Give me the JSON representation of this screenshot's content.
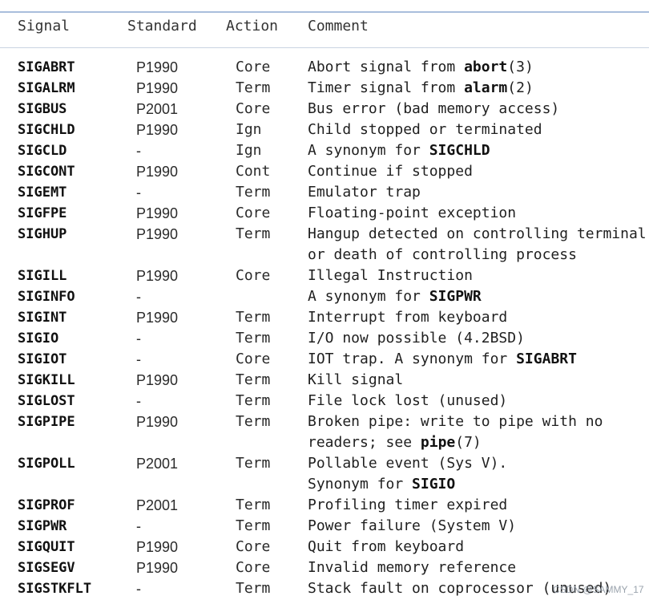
{
  "table": {
    "headers": {
      "signal": "Signal",
      "standard": "Standard",
      "action": "Action",
      "comment": "Comment"
    },
    "rows": [
      {
        "signal": "SIGABRT",
        "standard": "P1990",
        "action": "Core",
        "comment": [
          [
            {
              "t": "Abort signal from "
            },
            {
              "t": "abort",
              "b": true
            },
            {
              "t": "(3)"
            }
          ]
        ]
      },
      {
        "signal": "SIGALRM",
        "standard": "P1990",
        "action": "Term",
        "comment": [
          [
            {
              "t": "Timer signal from "
            },
            {
              "t": "alarm",
              "b": true
            },
            {
              "t": "(2)"
            }
          ]
        ]
      },
      {
        "signal": "SIGBUS",
        "standard": "P2001",
        "action": "Core",
        "comment": [
          [
            {
              "t": "Bus error (bad memory access)"
            }
          ]
        ]
      },
      {
        "signal": "SIGCHLD",
        "standard": "P1990",
        "action": "Ign",
        "comment": [
          [
            {
              "t": "Child stopped or terminated"
            }
          ]
        ]
      },
      {
        "signal": "SIGCLD",
        "standard": "-",
        "action": "Ign",
        "comment": [
          [
            {
              "t": "A synonym for "
            },
            {
              "t": "SIGCHLD",
              "b": true
            }
          ]
        ]
      },
      {
        "signal": "SIGCONT",
        "standard": "P1990",
        "action": "Cont",
        "comment": [
          [
            {
              "t": "Continue if stopped"
            }
          ]
        ]
      },
      {
        "signal": "SIGEMT",
        "standard": "-",
        "action": "Term",
        "comment": [
          [
            {
              "t": "Emulator trap"
            }
          ]
        ]
      },
      {
        "signal": "SIGFPE",
        "standard": "P1990",
        "action": "Core",
        "comment": [
          [
            {
              "t": "Floating-point exception"
            }
          ]
        ]
      },
      {
        "signal": "SIGHUP",
        "standard": "P1990",
        "action": "Term",
        "comment": [
          [
            {
              "t": "Hangup detected on controlling terminal"
            }
          ],
          [
            {
              "t": "or death of controlling process"
            }
          ]
        ]
      },
      {
        "signal": "SIGILL",
        "standard": "P1990",
        "action": "Core",
        "comment": [
          [
            {
              "t": "Illegal Instruction"
            }
          ]
        ]
      },
      {
        "signal": "SIGINFO",
        "standard": "-",
        "action": "",
        "comment": [
          [
            {
              "t": "A synonym for "
            },
            {
              "t": "SIGPWR",
              "b": true
            }
          ]
        ]
      },
      {
        "signal": "SIGINT",
        "standard": "P1990",
        "action": "Term",
        "comment": [
          [
            {
              "t": "Interrupt from keyboard"
            }
          ]
        ]
      },
      {
        "signal": "SIGIO",
        "standard": "-",
        "action": "Term",
        "comment": [
          [
            {
              "t": "I/O now possible (4.2BSD)"
            }
          ]
        ]
      },
      {
        "signal": "SIGIOT",
        "standard": "-",
        "action": "Core",
        "comment": [
          [
            {
              "t": "IOT trap. A synonym for "
            },
            {
              "t": "SIGABRT",
              "b": true
            }
          ]
        ]
      },
      {
        "signal": "SIGKILL",
        "standard": "P1990",
        "action": "Term",
        "comment": [
          [
            {
              "t": "Kill signal"
            }
          ]
        ]
      },
      {
        "signal": "SIGLOST",
        "standard": "-",
        "action": "Term",
        "comment": [
          [
            {
              "t": "File lock lost (unused)"
            }
          ]
        ]
      },
      {
        "signal": "SIGPIPE",
        "standard": "P1990",
        "action": "Term",
        "comment": [
          [
            {
              "t": "Broken pipe: write to pipe with no"
            }
          ],
          [
            {
              "t": "readers; see "
            },
            {
              "t": "pipe",
              "b": true
            },
            {
              "t": "(7)"
            }
          ]
        ]
      },
      {
        "signal": "SIGPOLL",
        "standard": "P2001",
        "action": "Term",
        "comment": [
          [
            {
              "t": "Pollable event (Sys V)."
            }
          ],
          [
            {
              "t": "Synonym for "
            },
            {
              "t": "SIGIO",
              "b": true
            }
          ]
        ]
      },
      {
        "signal": "SIGPROF",
        "standard": "P2001",
        "action": "Term",
        "comment": [
          [
            {
              "t": "Profiling timer expired"
            }
          ]
        ]
      },
      {
        "signal": "SIGPWR",
        "standard": "-",
        "action": "Term",
        "comment": [
          [
            {
              "t": "Power failure (System V)"
            }
          ]
        ]
      },
      {
        "signal": "SIGQUIT",
        "standard": "P1990",
        "action": "Core",
        "comment": [
          [
            {
              "t": "Quit from keyboard"
            }
          ]
        ]
      },
      {
        "signal": "SIGSEGV",
        "standard": "P1990",
        "action": "Core",
        "comment": [
          [
            {
              "t": "Invalid memory reference"
            }
          ]
        ]
      },
      {
        "signal": "SIGSTKFLT",
        "standard": "-",
        "action": "Term",
        "comment": [
          [
            {
              "t": "Stack fault on coprocessor (unused)"
            }
          ]
        ]
      }
    ]
  },
  "watermark": "CSDN @SAMMY_17"
}
